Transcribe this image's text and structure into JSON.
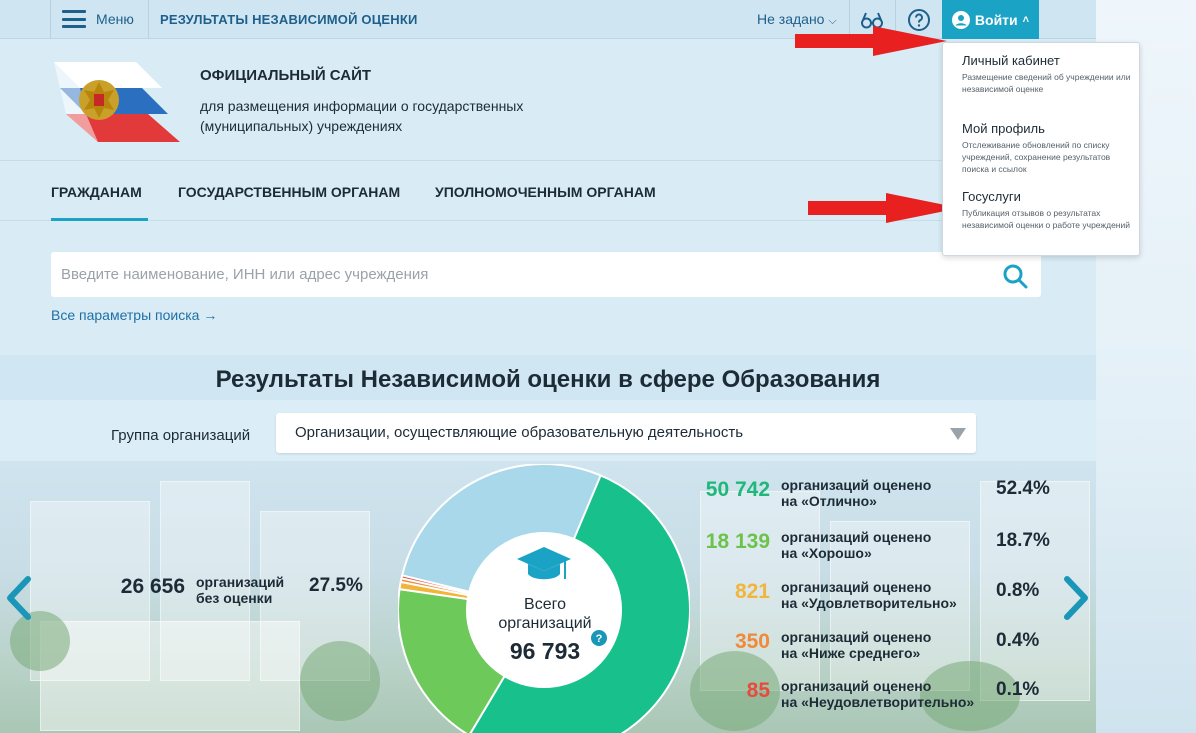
{
  "topbar": {
    "menu_label": "Меню",
    "title": "РЕЗУЛЬТАТЫ НЕЗАВИСИМОЙ ОЦЕНКИ",
    "region": "Не задано",
    "login_label": "Войти",
    "accent": "#1ba3c6"
  },
  "header": {
    "site_title": "ОФИЦИАЛЬНЫЙ САЙТ",
    "site_subtitle": "для размещения информации о государственных (муниципальных) учреждениях"
  },
  "nav": {
    "items": [
      "ГРАЖДАНАМ",
      "ГОСУДАРСТВЕННЫМ ОРГАНАМ",
      "УПОЛНОМОЧЕННЫМ ОРГАНАМ"
    ]
  },
  "search": {
    "placeholder": "Введите наименование, ИНН или адрес учреждения",
    "advanced_link": "Все параметры поиска →"
  },
  "results": {
    "title": "Результаты Независимой оценки в сфере Образования",
    "group_label": "Группа организаций",
    "group_value": "Организации, осуществляющие образовательную деятельность",
    "total_label_1": "Всего",
    "total_label_2": "организаций",
    "total_value": "96 793",
    "unrated": {
      "count": "26 656",
      "label_1": "организаций",
      "label_2": "без оценки",
      "pct": "27.5%",
      "color": "#4aa9c9"
    },
    "stats": [
      {
        "count": "50 742",
        "line1": "организаций оценено",
        "line2": "на «Отлично»",
        "pct": "52.4%",
        "color": "#1fb77a"
      },
      {
        "count": "18 139",
        "line1": "организаций оценено",
        "line2": "на «Хорошо»",
        "pct": "18.7%",
        "color": "#6cc24a"
      },
      {
        "count": "821",
        "line1": "организаций оценено",
        "line2": "на «Удовлетворительно»",
        "pct": "0.8%",
        "color": "#f2b53b"
      },
      {
        "count": "350",
        "line1": "организаций оценено",
        "line2": "на «Ниже среднего»",
        "pct": "0.4%",
        "color": "#f08a3a"
      },
      {
        "count": "85",
        "line1": "организаций оценено",
        "line2": "на «Неудовлетворительно»",
        "pct": "0.1%",
        "color": "#e84a3f"
      }
    ]
  },
  "dropdown": {
    "items": [
      {
        "title": "Личный кабинет",
        "desc": "Размещение сведений об учреждении или независимой оценке"
      },
      {
        "title": "Мой профиль",
        "desc": "Отслеживание обновлений по списку учреждений, сохранение результатов поиска и ссылок"
      },
      {
        "title": "Госуслуги",
        "desc": "Публикация отзывов о результатах независимой оценки о работе учреждений"
      }
    ]
  },
  "donut": {
    "segments": [
      {
        "name": "Отлично",
        "pct": 52.4,
        "color": "#18c08c"
      },
      {
        "name": "Хорошо",
        "pct": 18.7,
        "color": "#6cc95a"
      },
      {
        "name": "Удовлетворительно",
        "pct": 0.8,
        "color": "#f2b53b"
      },
      {
        "name": "Ниже среднего",
        "pct": 0.4,
        "color": "#f08a3a"
      },
      {
        "name": "Неудовлетворительно",
        "pct": 0.1,
        "color": "#e84a3f"
      },
      {
        "name": "без оценки",
        "pct": 27.5,
        "color": "#a9d8ea"
      }
    ]
  }
}
